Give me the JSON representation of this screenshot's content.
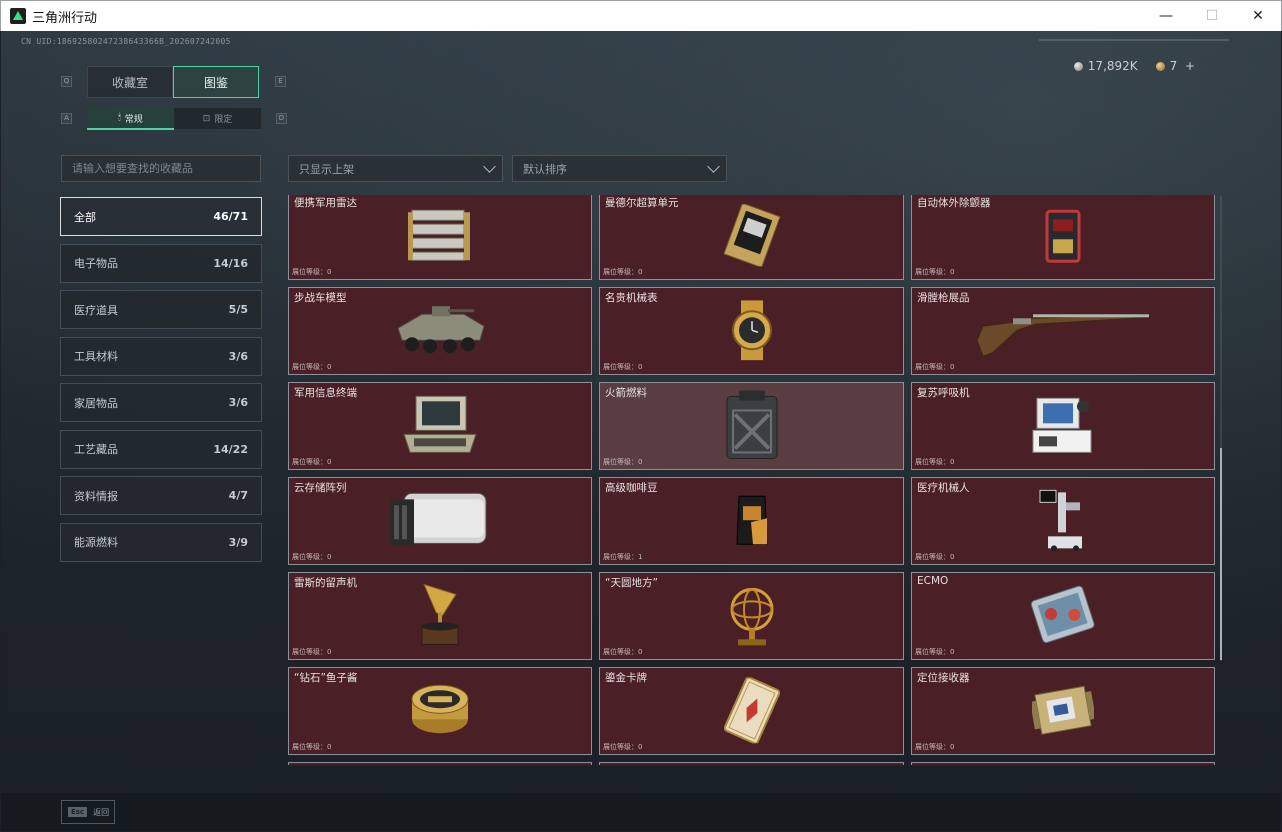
{
  "window": {
    "title": "三角洲行动",
    "minimize": "—",
    "maximize": "☐",
    "close": "✕"
  },
  "uid": "CN UID:18692580247238643366B_202607242005",
  "currency": {
    "silver": "17,892K",
    "gold": "7",
    "add": "+"
  },
  "tabs_main": [
    {
      "label": "收藏室",
      "active": false
    },
    {
      "label": "图鉴",
      "active": true
    }
  ],
  "tabs_sub": [
    {
      "label": "常规",
      "icon": "fire-icon",
      "active": true
    },
    {
      "label": "限定",
      "icon": "box-icon",
      "active": false
    }
  ],
  "key_hints": {
    "q": "Q",
    "e": "E",
    "a": "A",
    "d": "D"
  },
  "search": {
    "placeholder": "请输入想要查找的收藏品",
    "value": ""
  },
  "filters": {
    "filter_label": "只显示上架",
    "sort_label": "默认排序"
  },
  "categories": [
    {
      "label": "全部",
      "count": "46/71",
      "active": true
    },
    {
      "label": "电子物品",
      "count": "14/16",
      "active": false
    },
    {
      "label": "医疗道具",
      "count": "5/5",
      "active": false
    },
    {
      "label": "工具材料",
      "count": "3/6",
      "active": false
    },
    {
      "label": "家居物品",
      "count": "3/6",
      "active": false
    },
    {
      "label": "工艺藏品",
      "count": "14/22",
      "active": false
    },
    {
      "label": "资料情报",
      "count": "4/7",
      "active": false
    },
    {
      "label": "能源燃料",
      "count": "3/9",
      "active": false
    }
  ],
  "items": [
    {
      "name": "便携军用雷达",
      "level": "展位等级：0",
      "icon": "radar-icon"
    },
    {
      "name": "曼德尔超算单元",
      "level": "展位等级：0",
      "icon": "computing-unit-icon"
    },
    {
      "name": "自动体外除颤器",
      "level": "展位等级：0",
      "icon": "defibrillator-icon"
    },
    {
      "name": "步战车模型",
      "level": "展位等级：0",
      "icon": "ifv-model-icon"
    },
    {
      "name": "名贵机械表",
      "level": "展位等级：0",
      "icon": "watch-icon"
    },
    {
      "name": "滑膛枪展品",
      "level": "展位等级：0",
      "icon": "musket-icon"
    },
    {
      "name": "军用信息终端",
      "level": "展位等级：0",
      "icon": "terminal-icon"
    },
    {
      "name": "火箭燃料",
      "level": "展位等级：0",
      "icon": "fuel-can-icon",
      "highlight": true
    },
    {
      "name": "复苏呼吸机",
      "level": "展位等级：0",
      "icon": "ventilator-icon"
    },
    {
      "name": "云存储阵列",
      "level": "展位等级：0",
      "icon": "storage-array-icon"
    },
    {
      "name": "高级咖啡豆",
      "level": "展位等级：1",
      "icon": "coffee-bag-icon"
    },
    {
      "name": "医疗机械人",
      "level": "展位等级：0",
      "icon": "medical-robot-icon"
    },
    {
      "name": "雷斯的留声机",
      "level": "展位等级：0",
      "icon": "gramophone-icon"
    },
    {
      "name": "“天圆地方”",
      "level": "展位等级：0",
      "icon": "armillary-icon"
    },
    {
      "name": "ECMO",
      "level": "展位等级：0",
      "icon": "ecmo-icon"
    },
    {
      "name": "“钻石”鱼子酱",
      "level": "展位等级：0",
      "icon": "caviar-icon"
    },
    {
      "name": "鎏金卡牌",
      "level": "展位等级：0",
      "icon": "gold-card-icon"
    },
    {
      "name": "定位接收器",
      "level": "展位等级：0",
      "icon": "gps-receiver-icon"
    }
  ],
  "bottom": {
    "esc_key": "Esc",
    "esc_label": "返回"
  },
  "colors": {
    "accent": "#4fd1a0",
    "card_bg": "#4a1f26",
    "card_highlight": "#5a3d40"
  }
}
